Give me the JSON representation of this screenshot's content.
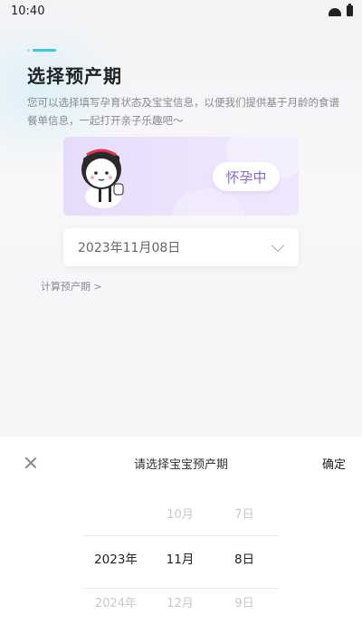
{
  "status_bar": {
    "time": "10:40",
    "wifi_icon": "wifi-icon",
    "battery_icon": "battery-icon"
  },
  "header": {
    "title": "选择预产期",
    "description": "您可以选择填写孕育状态及宝宝信息，以便我们提供基于月龄的食谱餐单信息，一起打开亲子乐趣吧～"
  },
  "status_card": {
    "label": "怀孕中",
    "accent_color": "#8b63d9",
    "background_color": "#e8dffb"
  },
  "date_field": {
    "value": "2023年11月08日",
    "icon": "chevron-down-icon"
  },
  "calc_link": "计算预产期 >",
  "picker_sheet": {
    "title": "请选择宝宝预产期",
    "close_icon": "close-icon",
    "confirm_label": "确定",
    "columns": {
      "year": {
        "above": "",
        "selected": "2023年",
        "below": "2024年"
      },
      "month": {
        "above": "10月",
        "selected": "11月",
        "below": "12月"
      },
      "day": {
        "above": "7日",
        "selected": "8日",
        "below": "9日"
      }
    }
  }
}
